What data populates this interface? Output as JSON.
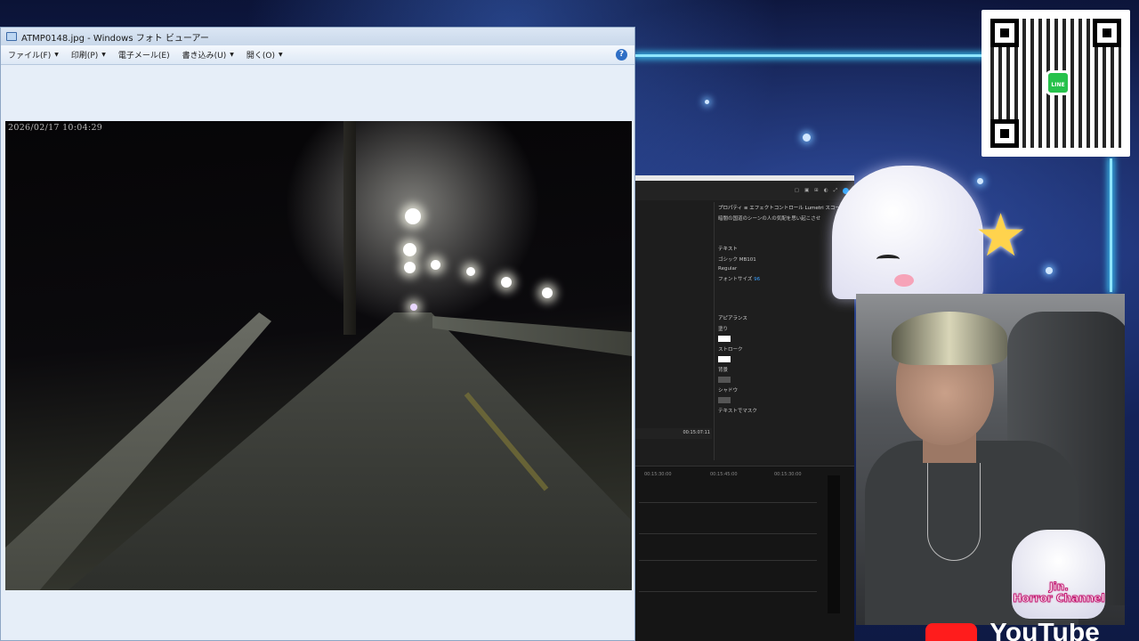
{
  "viewer": {
    "title": "ATMP0148.jpg - Windows フォト ビューアー",
    "menu": [
      {
        "label": "ファイル(F)"
      },
      {
        "label": "印刷(P)"
      },
      {
        "label": "電子メール(E)"
      },
      {
        "label": "書き込み(U)"
      },
      {
        "label": "開く(O)"
      }
    ],
    "help_glyph": "?",
    "photo": {
      "timestamp": "2026/02/17 10:04:29"
    }
  },
  "editor": {
    "timecode": "00:15:07:11",
    "ruler_marks": [
      "00:15:30:00",
      "00:15:45:00",
      "00:15:30:00"
    ],
    "panel": {
      "tabs": "プロパティ ≡   エフェクトコントロール   Lumetri スコープ",
      "clip_title": "暗闇の国道のシーンの人の気配を思い起こさせ",
      "text_section": "テキスト",
      "font_value": "ゴシック MB101",
      "style_value": "Regular",
      "font_size_label": "フォントサイズ",
      "font_size_value": "96",
      "appearance_label": "アピアランス",
      "fill_label": "塗り",
      "stroke_label": "ストローク",
      "background_label": "背景",
      "shadow_label": "シャドウ",
      "mask_label": "テキストでマスク"
    }
  },
  "qr": {
    "badge_text": "LINE"
  },
  "webcam": {
    "logo_line1": "Jin.",
    "logo_line2": "Horror Channel"
  },
  "footer": {
    "youtube_word": "YouTube"
  },
  "colors": {
    "accent_neon": "#8fe6ff",
    "line_green": "#27c24c",
    "youtube_red": "#ff1c1c"
  }
}
